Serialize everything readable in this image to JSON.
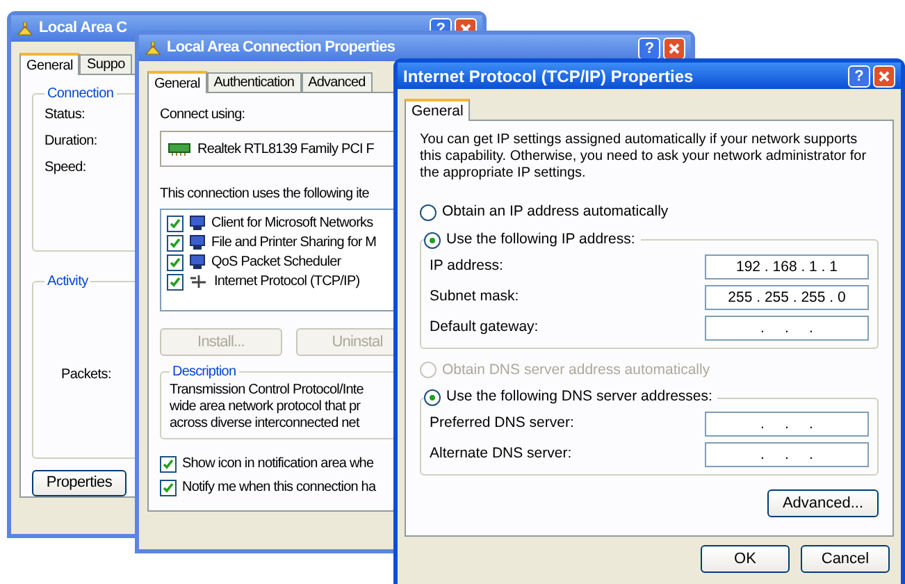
{
  "status_window": {
    "title": "Local Area C",
    "help_button": "?",
    "tabs": [
      {
        "label": "General",
        "selected": true
      },
      {
        "label": "Suppo",
        "selected": false
      }
    ],
    "connection_group": {
      "title": "Connection",
      "labels": [
        "Status:",
        "Duration:",
        "Speed:"
      ]
    },
    "activity_group": {
      "title": "Activity",
      "labels": [
        "Packets:"
      ]
    },
    "button": "Properties"
  },
  "properties_window": {
    "title": "Local Area Connection Properties",
    "help_button": "?",
    "tabs": [
      {
        "label": "General",
        "selected": true
      },
      {
        "label": "Authentication",
        "selected": false
      },
      {
        "label": "Advanced",
        "selected": false
      }
    ],
    "connect_using_label": "Connect using:",
    "adapter": "Realtek RTL8139 Family PCI F",
    "items_label": "This connection uses the following ite",
    "items": [
      {
        "label": "Client for Microsoft Networks",
        "checked": true,
        "kind": "computer"
      },
      {
        "label": "File and Printer Sharing for M",
        "checked": true,
        "kind": "computer"
      },
      {
        "label": "QoS Packet Scheduler",
        "checked": true,
        "kind": "computer"
      },
      {
        "label": "Internet Protocol (TCP/IP)",
        "checked": true,
        "kind": "protocol"
      }
    ],
    "buttons": [
      {
        "label": "Install...",
        "disabled": true
      },
      {
        "label": "Uninstal",
        "disabled": true
      }
    ],
    "description": {
      "title": "Description",
      "lines": [
        "Transmission Control Protocol/Inte",
        "wide area network protocol that pr",
        "across diverse interconnected net"
      ]
    },
    "options": [
      {
        "label": "Show icon in notification area whe",
        "checked": true
      },
      {
        "label": "Notify me when this connection ha",
        "checked": true
      }
    ]
  },
  "tcpip_window": {
    "title": "Internet Protocol (TCP/IP) Properties",
    "help_button": "?",
    "tabs": [
      {
        "label": "General",
        "selected": true
      }
    ],
    "intro": "You can get IP settings assigned automatically if your network supports this capability. Otherwise, you need to ask your network administrator for the appropriate IP settings.",
    "ip_radios": [
      {
        "label": "Obtain an IP address automatically",
        "selected": false,
        "disabled": false
      },
      {
        "label": "Use the following IP address:",
        "selected": true,
        "disabled": false
      }
    ],
    "ip_fields": [
      {
        "label": "IP address:",
        "value": "192 . 168 . 1 . 1"
      },
      {
        "label": "Subnet mask:",
        "value": "255 . 255 . 255 . 0"
      },
      {
        "label": "Default gateway:",
        "value": ".     .     ."
      }
    ],
    "dns_radios": [
      {
        "label": "Obtain DNS server address automatically",
        "selected": false,
        "disabled": true
      },
      {
        "label": "Use the following DNS server addresses:",
        "selected": true,
        "disabled": false
      }
    ],
    "dns_fields": [
      {
        "label": "Preferred DNS server:",
        "value": ".     .     ."
      },
      {
        "label": "Alternate DNS server:",
        "value": ".     .     ."
      }
    ],
    "advanced_button": "Advanced...",
    "buttons": [
      "OK",
      "Cancel"
    ]
  }
}
